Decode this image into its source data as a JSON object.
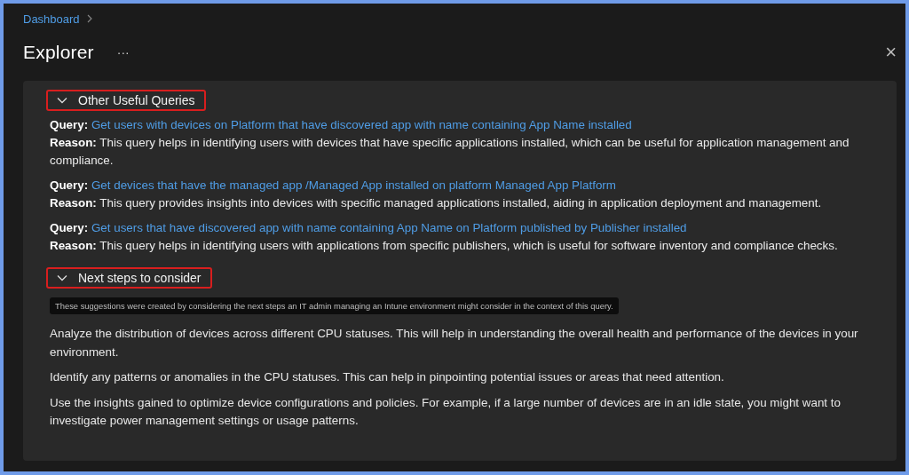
{
  "breadcrumb": {
    "items": [
      "Dashboard"
    ]
  },
  "title": "Explorer",
  "more_button": "···",
  "close_button": "×",
  "sections": [
    {
      "kind": "queries",
      "title": "Other Useful Queries",
      "expanded": true,
      "highlighted": true,
      "items": [
        {
          "query_label": "Query:",
          "query": "Get users with devices on Platform that have discovered app with name containing App Name installed",
          "reason_label": "Reason:",
          "reason": "This query helps in identifying users with devices that have specific applications installed, which can be useful for application management and compliance."
        },
        {
          "query_label": "Query:",
          "query": "Get devices that have the managed app /Managed App installed on platform Managed App Platform",
          "reason_label": "Reason:",
          "reason": "This query provides insights into devices with specific managed applications installed, aiding in application deployment and management."
        },
        {
          "query_label": "Query:",
          "query": "Get users that have discovered app with name containing App Name on Platform published by Publisher installed",
          "reason_label": "Reason:",
          "reason": "This query helps in identifying users with applications from specific publishers, which is useful for software inventory and compliance checks."
        }
      ]
    },
    {
      "kind": "steps",
      "title": "Next steps to consider",
      "expanded": true,
      "highlighted": true,
      "note": "These suggestions were created by considering the next steps an IT admin managing an Intune environment might consider in the context of this query.",
      "items": [
        "Analyze the distribution of devices across different CPU statuses. This will help in understanding the overall health and performance of the devices in your environment.",
        "Identify any patterns or anomalies in the CPU statuses. This can help in pinpointing potential issues or areas that need attention.",
        "Use the insights gained to optimize device configurations and policies. For example, if a large number of devices are in an idle state, you might want to investigate power management settings or usage patterns."
      ]
    }
  ]
}
